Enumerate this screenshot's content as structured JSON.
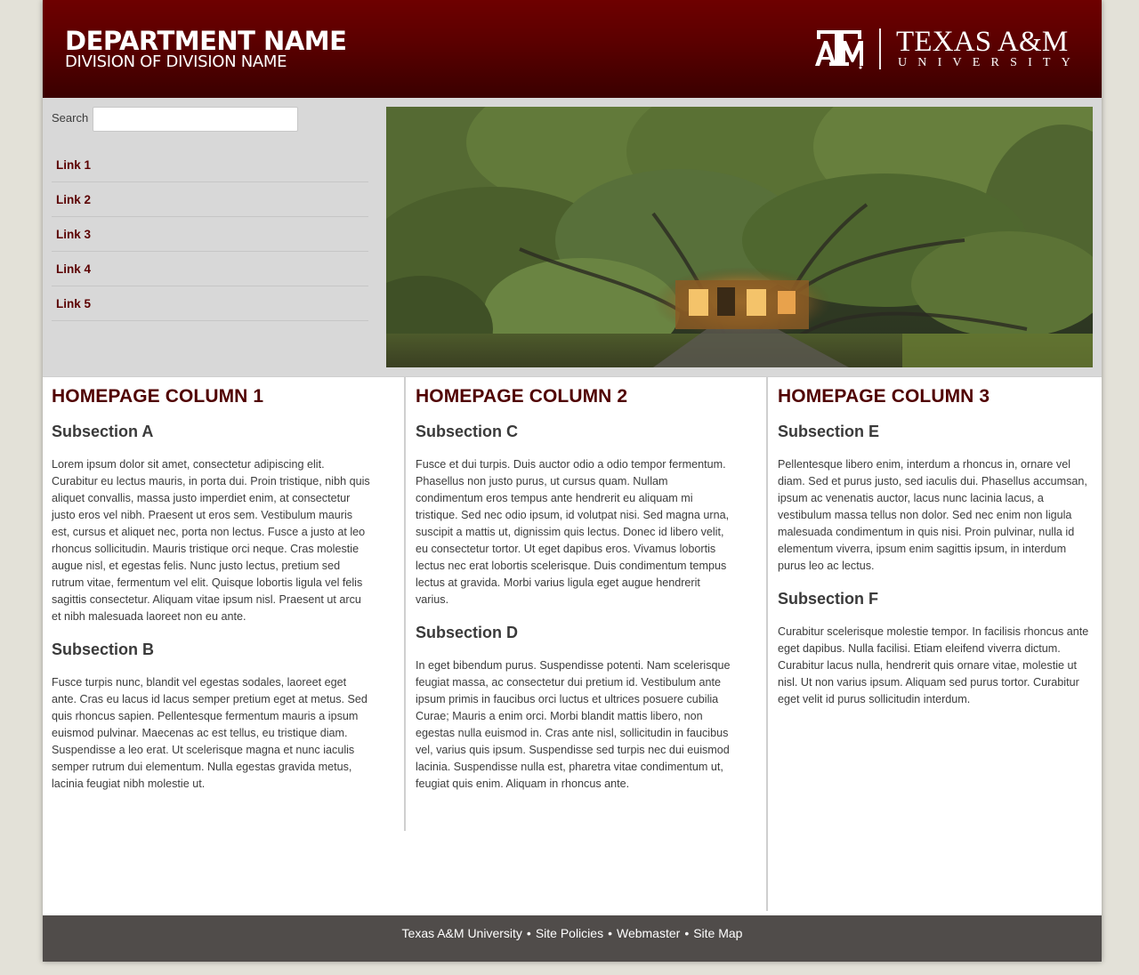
{
  "header": {
    "department_name": "DEPARTMENT NAME",
    "division_name": "DIVISION OF DIVISION NAME",
    "logo": {
      "title": "TEXAS A&M",
      "subtitle": "UNIVERSITY",
      "mark_icon": "atm-logo-icon"
    }
  },
  "search": {
    "label": "Search",
    "placeholder": "",
    "value": ""
  },
  "nav": {
    "items": [
      {
        "label": "Link 1"
      },
      {
        "label": "Link 2"
      },
      {
        "label": "Link 3"
      },
      {
        "label": "Link 4"
      },
      {
        "label": "Link 5"
      }
    ]
  },
  "columns": [
    {
      "title": "HOMEPAGE COLUMN 1",
      "sections": [
        {
          "heading": "Subsection A",
          "body": "Lorem ipsum dolor sit amet, consectetur adipiscing elit. Curabitur eu lectus mauris, in porta dui. Proin tristique, nibh quis aliquet convallis, massa justo imperdiet enim, at consectetur justo eros vel nibh. Praesent ut eros sem. Vestibulum mauris est, cursus et aliquet nec, porta non lectus. Fusce a justo at leo rhoncus sollicitudin. Mauris tristique orci neque. Cras molestie augue nisl, et egestas felis. Nunc justo lectus, pretium sed rutrum vitae, fermentum vel elit. Quisque lobortis ligula vel felis sagittis consectetur. Aliquam vitae ipsum nisl. Praesent ut arcu et nibh malesuada laoreet non eu ante."
        },
        {
          "heading": "Subsection B",
          "body": "Fusce turpis nunc, blandit vel egestas sodales, laoreet eget ante. Cras eu lacus id lacus semper pretium eget at metus. Sed quis rhoncus sapien. Pellentesque fermentum mauris a ipsum euismod pulvinar. Maecenas ac est tellus, eu tristique diam. Suspendisse a leo erat. Ut scelerisque magna et nunc iaculis semper rutrum dui elementum. Nulla egestas gravida metus, lacinia feugiat nibh molestie ut."
        }
      ]
    },
    {
      "title": "HOMEPAGE COLUMN 2",
      "sections": [
        {
          "heading": "Subsection C",
          "body": "Fusce et dui turpis. Duis auctor odio a odio tempor fermentum. Phasellus non justo purus, ut cursus quam. Nullam condimentum eros tempus ante hendrerit eu aliquam mi tristique. Sed nec odio ipsum, id volutpat nisi. Sed magna urna, suscipit a mattis ut, dignissim quis lectus. Donec id libero velit, eu consectetur tortor. Ut eget dapibus eros. Vivamus lobortis lectus nec erat lobortis scelerisque. Duis condimentum tempus lectus at gravida. Morbi varius ligula eget augue hendrerit varius."
        },
        {
          "heading": "Subsection D",
          "body": "In eget bibendum purus. Suspendisse potenti. Nam scelerisque feugiat massa, ac consectetur dui pretium id. Vestibulum ante ipsum primis in faucibus orci luctus et ultrices posuere cubilia Curae; Mauris a enim orci. Morbi blandit mattis libero, non egestas nulla euismod in. Cras ante nisl, sollicitudin in faucibus vel, varius quis ipsum. Suspendisse sed turpis nec dui euismod lacinia. Suspendisse nulla est, pharetra vitae condimentum ut, feugiat quis enim. Aliquam in rhoncus ante."
        }
      ]
    },
    {
      "title": "HOMEPAGE COLUMN 3",
      "sections": [
        {
          "heading": "Subsection E",
          "body": "Pellentesque libero enim, interdum a rhoncus in, ornare vel diam. Sed et purus justo, sed iaculis dui. Phasellus accumsan, ipsum ac venenatis auctor, lacus nunc lacinia lacus, a vestibulum massa tellus non dolor. Sed nec enim non ligula malesuada condimentum in quis nisi. Proin pulvinar, nulla id elementum viverra, ipsum enim sagittis ipsum, in interdum purus leo ac lectus."
        },
        {
          "heading": "Subsection F",
          "body": "Curabitur scelerisque molestie tempor. In facilisis rhoncus ante eget dapibus. Nulla facilisi. Etiam eleifend viverra dictum. Curabitur lacus nulla, hendrerit quis ornare vitae, molestie ut nisl. Ut non varius ipsum. Aliquam sed purus tortor. Curabitur eget velit id purus sollicitudin interdum."
        }
      ]
    }
  ],
  "footer": {
    "links": [
      {
        "label": "Texas A&M University"
      },
      {
        "label": "Site Policies"
      },
      {
        "label": "Webmaster"
      },
      {
        "label": "Site Map"
      }
    ],
    "separator": "•"
  },
  "colors": {
    "maroon": "#500000",
    "header_dark": "#3a0000",
    "banner_bg": "#d8d8d8",
    "footer_bg": "#504c4a",
    "page_bg": "#e3e1d8"
  }
}
